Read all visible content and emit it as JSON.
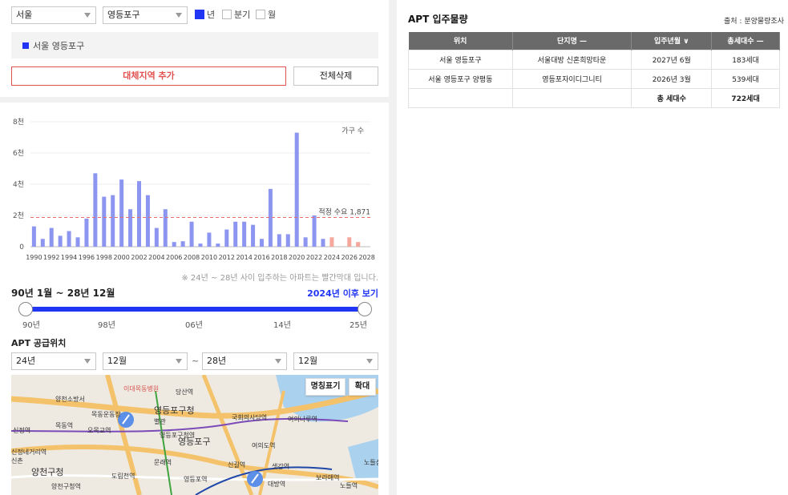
{
  "filters": {
    "city": "서울",
    "district": "영등포구",
    "period_options": [
      {
        "label": "년",
        "checked": true
      },
      {
        "label": "분기",
        "checked": false
      },
      {
        "label": "월",
        "checked": false
      }
    ]
  },
  "selected_region": "서울 영등포구",
  "buttons": {
    "add_region": "대체지역 추가",
    "delete_all": "전체삭제"
  },
  "chart_data": {
    "type": "bar",
    "legend_label": "가구 수",
    "y_ticks": [
      "0",
      "2천",
      "4천",
      "6천",
      "8천"
    ],
    "ylim": [
      0,
      8000
    ],
    "x_tick_labels": [
      "1990",
      "1992",
      "1994",
      "1996",
      "1998",
      "2000",
      "2002",
      "2004",
      "2006",
      "2008",
      "2010",
      "2012",
      "2014",
      "2016",
      "2018",
      "2020",
      "2022",
      "2024",
      "2026",
      "2028"
    ],
    "series": [
      {
        "years": [
          1990,
          1991,
          1992,
          1993,
          1994,
          1995,
          1996,
          1997,
          1998,
          1999,
          2000,
          2001,
          2002,
          2003,
          2004,
          2005,
          2006,
          2007,
          2008,
          2009,
          2010,
          2011,
          2012,
          2013,
          2014,
          2015,
          2016,
          2017,
          2018,
          2019,
          2020,
          2021,
          2022,
          2023
        ],
        "values": [
          1300,
          500,
          1200,
          700,
          1000,
          600,
          1800,
          4700,
          3200,
          3300,
          4300,
          2400,
          4200,
          3300,
          1200,
          2400,
          300,
          350,
          1600,
          200,
          900,
          200,
          1100,
          1600,
          1600,
          1400,
          500,
          3700,
          800,
          800,
          7300,
          600,
          2000,
          500
        ],
        "color": "#8c96f0"
      },
      {
        "years": [
          2024,
          2026,
          2027
        ],
        "values": [
          600,
          600,
          300
        ],
        "color": "#f4a79a"
      }
    ],
    "reference_line": {
      "value": 1871,
      "label": "적정 수요 1,871",
      "color": "#e86c6c"
    }
  },
  "chart_note": "※ 24년 ~ 28년 사이 입주하는 아파트는 빨간막대 입니다.",
  "period": {
    "label": "90년 1월 ~ 28년 12월",
    "view_after": "2024년 이후 보기",
    "range_start": "90년",
    "range_end": "28년"
  },
  "slider_ticks": [
    "90년",
    "98년",
    "06년",
    "14년",
    "25년"
  ],
  "supply": {
    "title": "APT 공급위치",
    "from_year": "24년",
    "from_month": "12월",
    "to_year": "28년",
    "to_month": "12월",
    "tilde": "~"
  },
  "map": {
    "btn_names": "명칭표기",
    "btn_zoom": "확대",
    "labels": [
      "이대목동병원",
      "당산역",
      "양천소방서",
      "목동운동장",
      "영등포구청",
      "별관",
      "국회의사당역",
      "여의나루역",
      "신정역",
      "목동역",
      "오목교역",
      "영등포구청역",
      "영등포구",
      "여의도역",
      "신정네거리역",
      "문래역",
      "샛강역",
      "양천구청",
      "도림천역",
      "신길역",
      "영등포역",
      "대방역",
      "보라매역",
      "노들역",
      "양천구청역",
      "신촌",
      "노들섬"
    ]
  },
  "apt": {
    "title": "APT 입주물량",
    "source": "출처 : 분양물량조사",
    "headers": [
      "위치",
      "단지명 —",
      "입주년월 ∨",
      "총세대수 —"
    ],
    "rows": [
      [
        "서울 영등포구",
        "서울대방 신혼희망타운",
        "2027년 6월",
        "183세대"
      ],
      [
        "서울 영등포구 양평동",
        "영등포자이디그니티",
        "2026년 3월",
        "539세대"
      ]
    ],
    "total_label": "총 세대수",
    "total_value": "722세대"
  }
}
